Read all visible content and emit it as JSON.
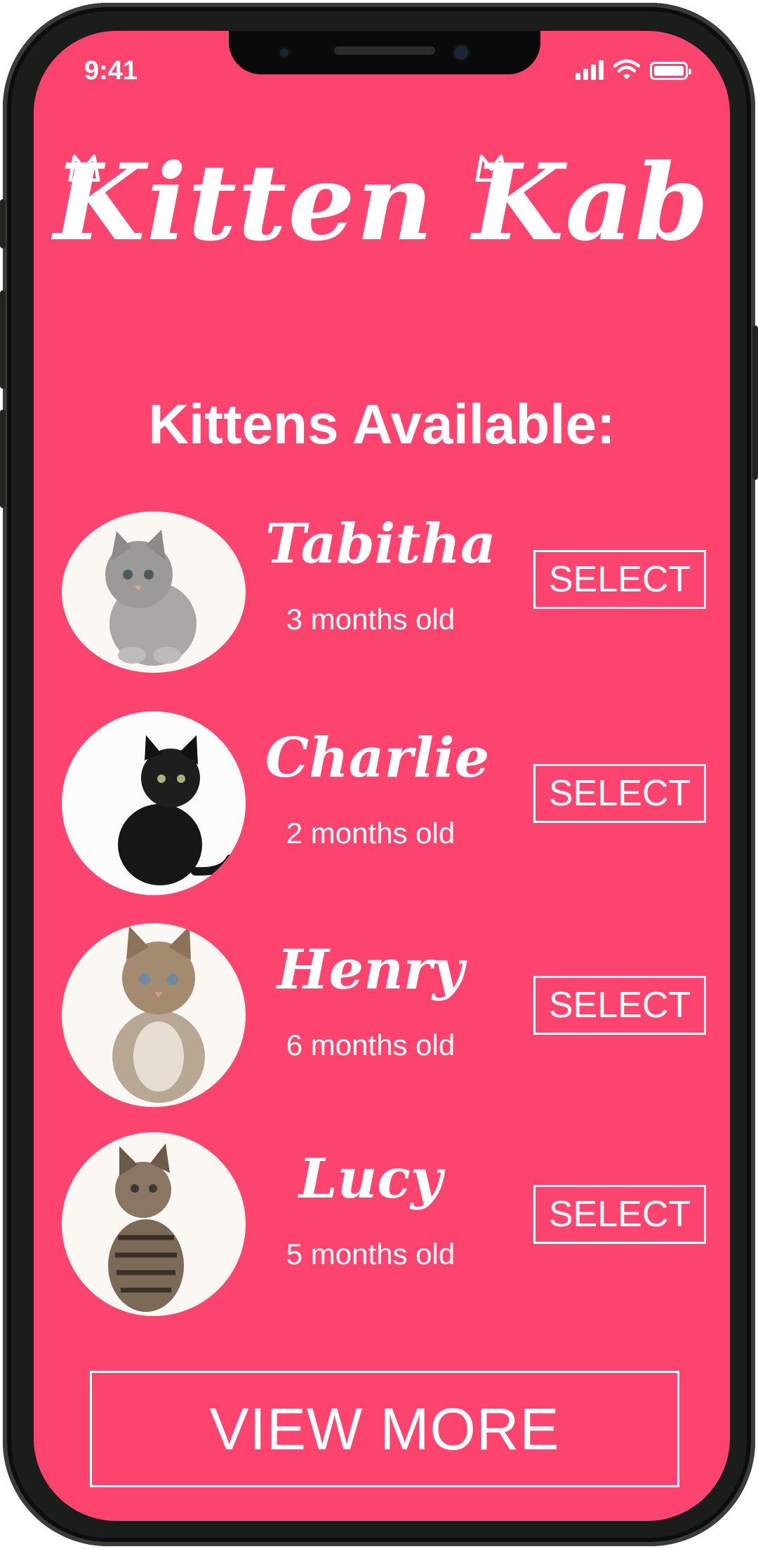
{
  "status_bar": {
    "time": "9:41"
  },
  "app": {
    "title": "Kitten Kab"
  },
  "section_title": "Kittens Available:",
  "kittens": [
    {
      "name": "Tabitha",
      "age": "3 months old",
      "select_label": "SELECT",
      "fur": "grey"
    },
    {
      "name": "Charlie",
      "age": "2 months old",
      "select_label": "SELECT",
      "fur": "black"
    },
    {
      "name": "Henry",
      "age": "6 months old",
      "select_label": "SELECT",
      "fur": "brown-tabby"
    },
    {
      "name": "Lucy",
      "age": "5 months old",
      "select_label": "SELECT",
      "fur": "striped-tabby"
    }
  ],
  "view_more_label": "VIEW MORE",
  "colors": {
    "background": "#fd446f",
    "text": "#ffffff",
    "phone_frame": "#1b1d1a"
  },
  "icons": {
    "signal": "signal-icon",
    "wifi": "wifi-icon",
    "battery": "battery-icon",
    "cat_ear": "cat-ear-icon"
  }
}
